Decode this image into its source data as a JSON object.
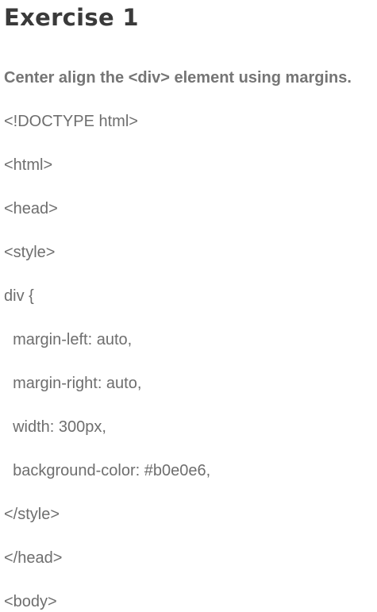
{
  "title": "Exercise 1",
  "instruction": "Center align the <div> element using margins.",
  "code_lines": [
    "<!DOCTYPE html>",
    "<html>",
    "<head>",
    "<style>",
    "div {",
    "  margin-left: auto,",
    "  margin-right: auto,",
    "  width: 300px,",
    "  background-color: #b0e0e6,",
    "</style>",
    "</head>",
    "<body>"
  ]
}
